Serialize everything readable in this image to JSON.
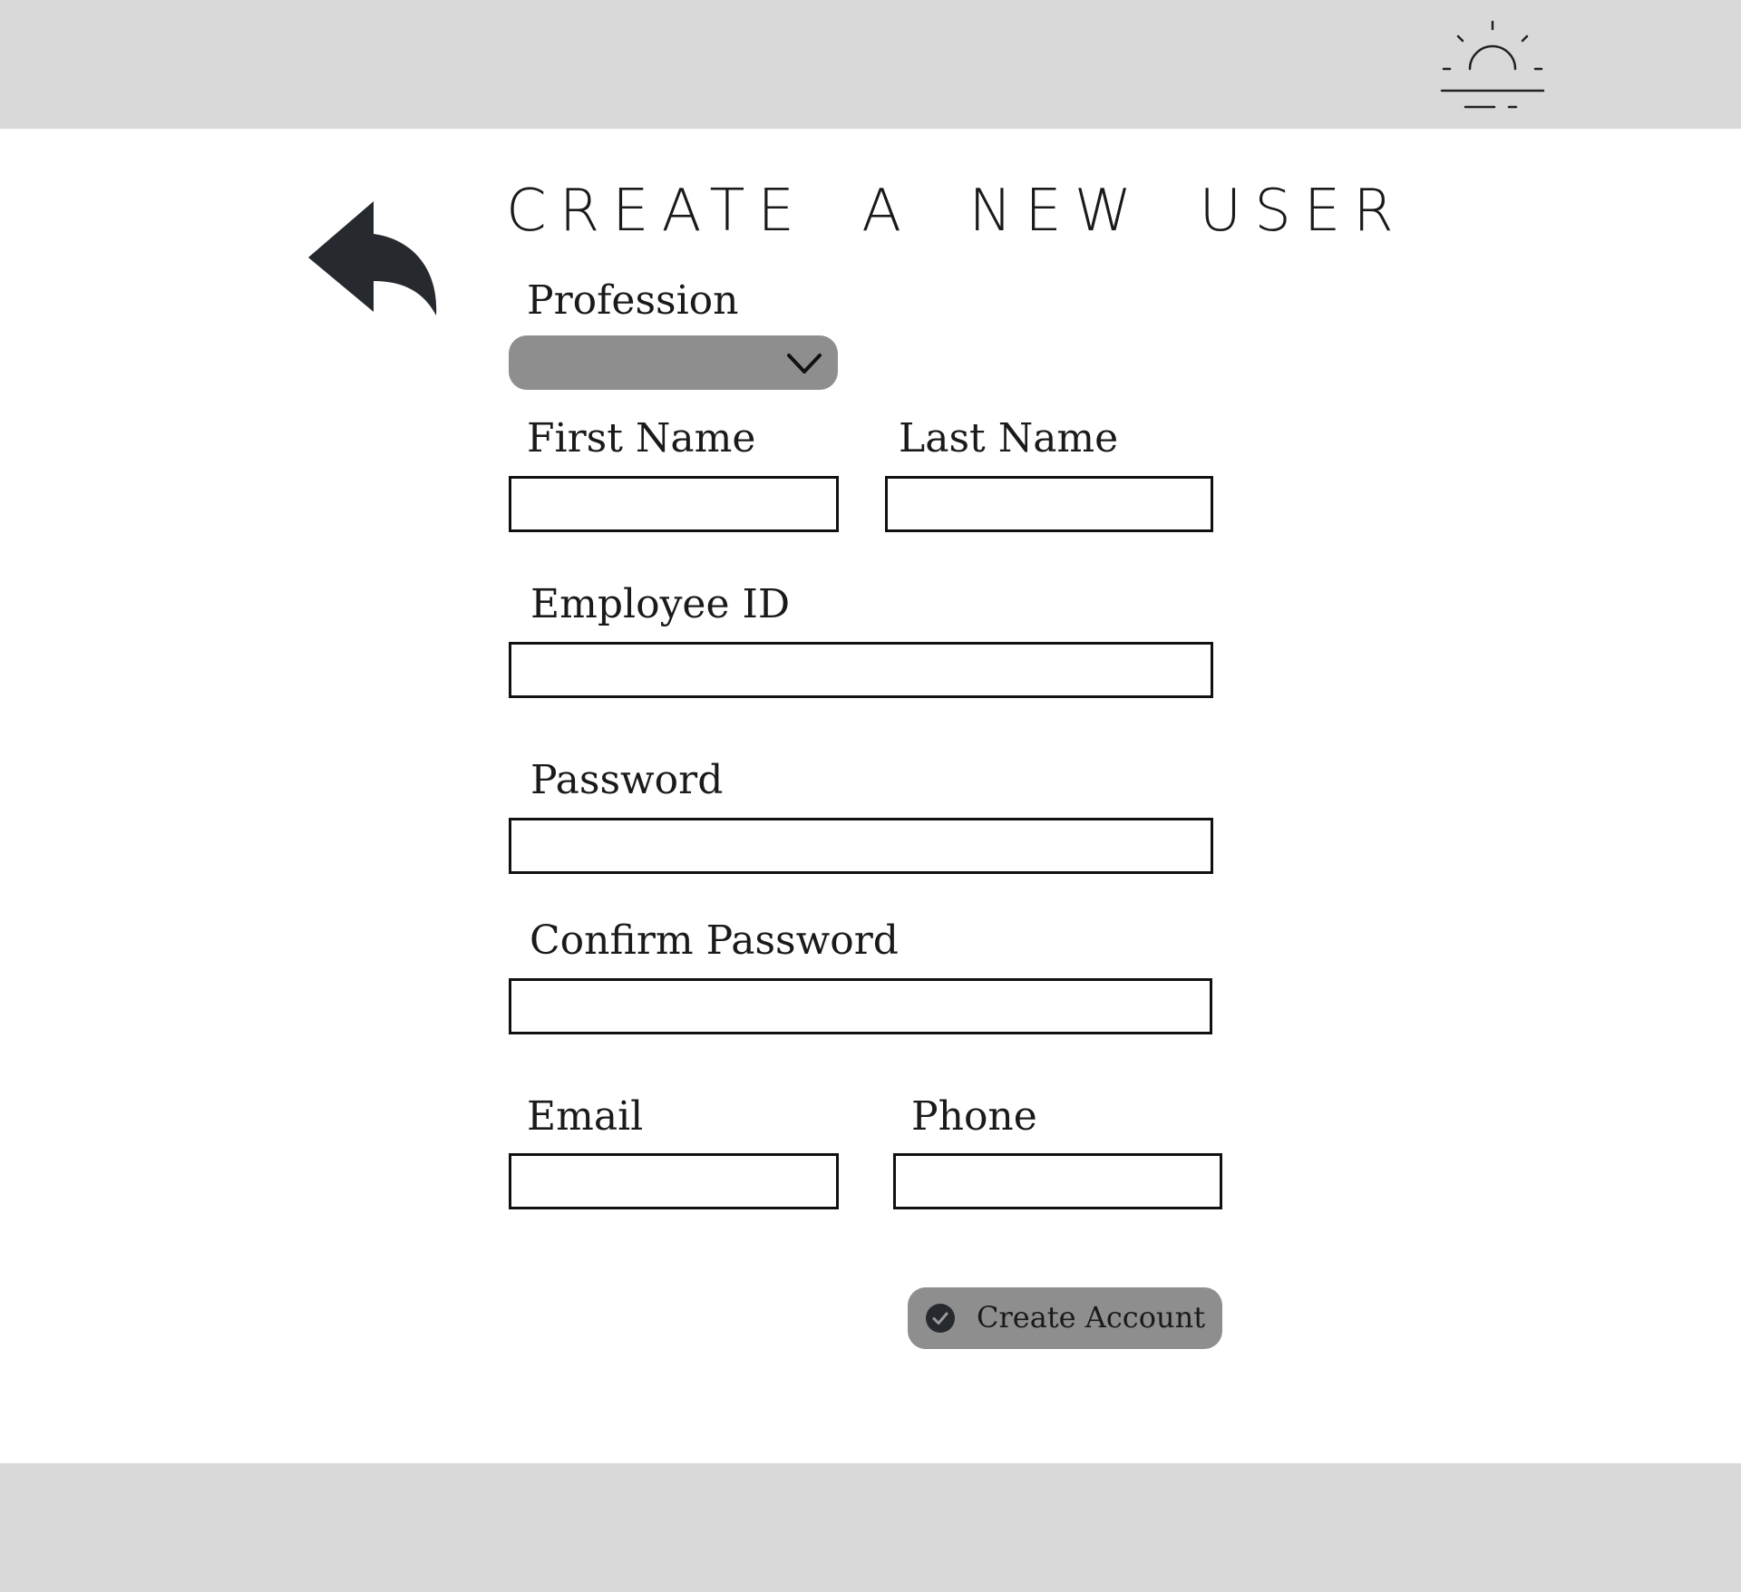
{
  "header": {
    "logo_icon": "sunrise-icon"
  },
  "back": {
    "icon": "reply-arrow-icon"
  },
  "title": "CREATE A NEW USER",
  "form": {
    "profession": {
      "label": "Profession",
      "value": "",
      "icon": "chevron-down-icon"
    },
    "first_name": {
      "label": "First Name",
      "value": ""
    },
    "last_name": {
      "label": "Last Name",
      "value": ""
    },
    "employee_id": {
      "label": "Employee ID",
      "value": ""
    },
    "password": {
      "label": "Password",
      "value": ""
    },
    "confirm_password": {
      "label": "Confirm Password",
      "value": ""
    },
    "email": {
      "label": "Email",
      "value": ""
    },
    "phone": {
      "label": "Phone",
      "value": ""
    }
  },
  "submit": {
    "label": "Create Account",
    "icon": "check-circle-icon"
  },
  "colors": {
    "chrome_bar": "#d9d9d9",
    "control_fill": "#8e8e8e",
    "icon_dark": "#26292d",
    "border": "#111111"
  }
}
